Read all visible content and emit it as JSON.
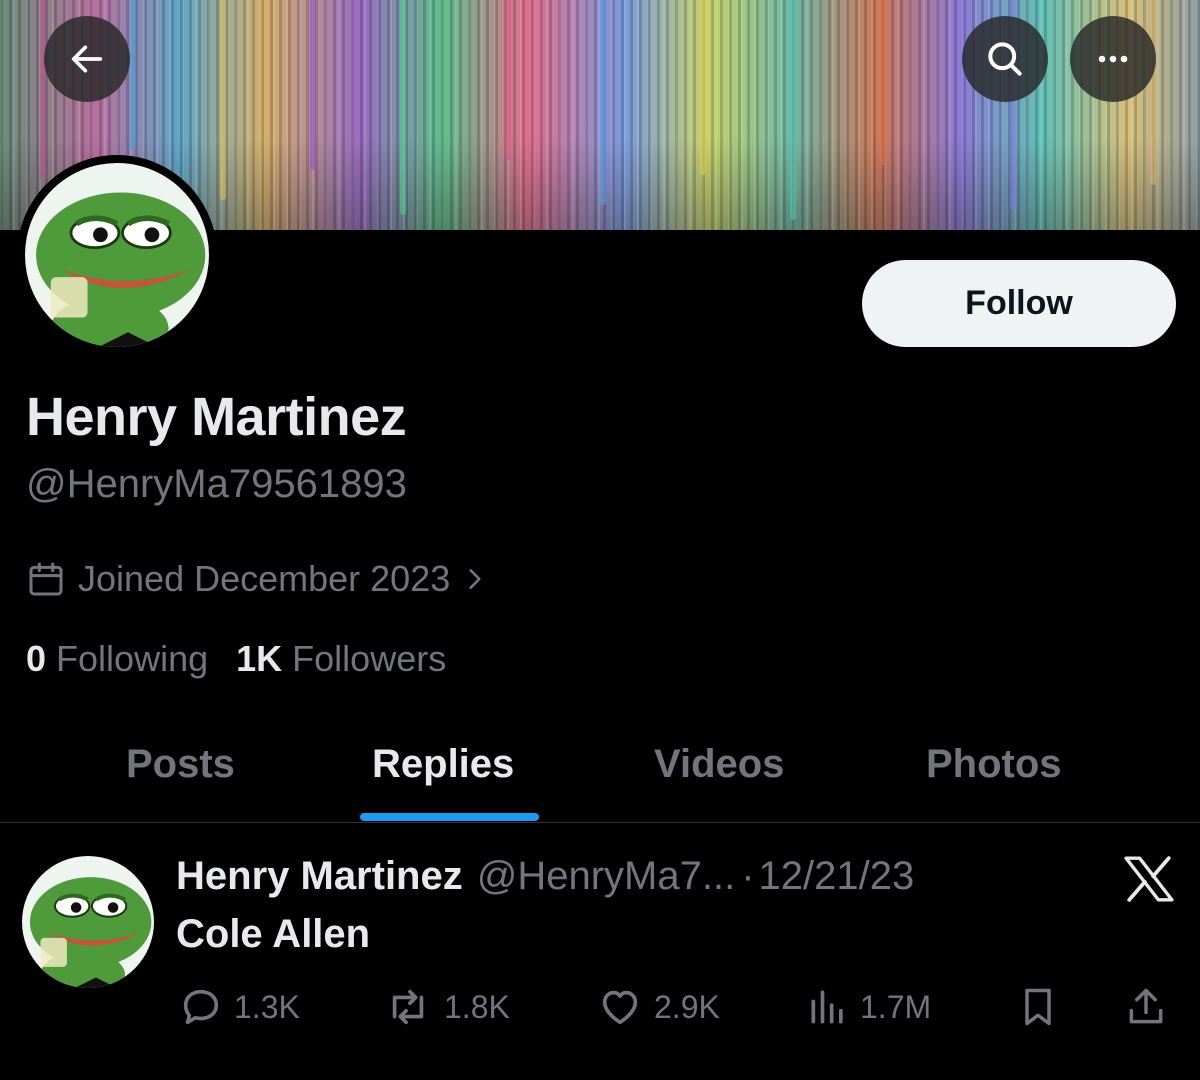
{
  "profile": {
    "display_name": "Henry Martinez",
    "handle": "@HenryMa79561893",
    "joined": "Joined December 2023",
    "following_count": "0",
    "following_label": "Following",
    "followers_count": "1K",
    "followers_label": "Followers",
    "follow_label": "Follow",
    "avatar": "pepe-frog-avatar"
  },
  "header_icons": [
    "back-arrow-icon",
    "search-icon",
    "more-icon"
  ],
  "tabs": [
    {
      "label": "Posts",
      "active": false
    },
    {
      "label": "Replies",
      "active": true
    },
    {
      "label": "Videos",
      "active": false
    },
    {
      "label": "Photos",
      "active": false
    }
  ],
  "post": {
    "author_name": "Henry Martinez",
    "author_handle": "@HenryMa7...",
    "separator": "·",
    "date": "12/21/23",
    "text": "Cole Allen",
    "replies": "1.3K",
    "reposts": "1.8K",
    "likes": "2.9K",
    "views": "1.7M"
  },
  "colors": {
    "background": "#000000",
    "primary_text": "#e7e9ea",
    "secondary_text": "#71767b",
    "accent": "#1d9bf0",
    "follow_button_bg": "#eff3f4",
    "avatar_frog_green": "#4f9a3a"
  }
}
